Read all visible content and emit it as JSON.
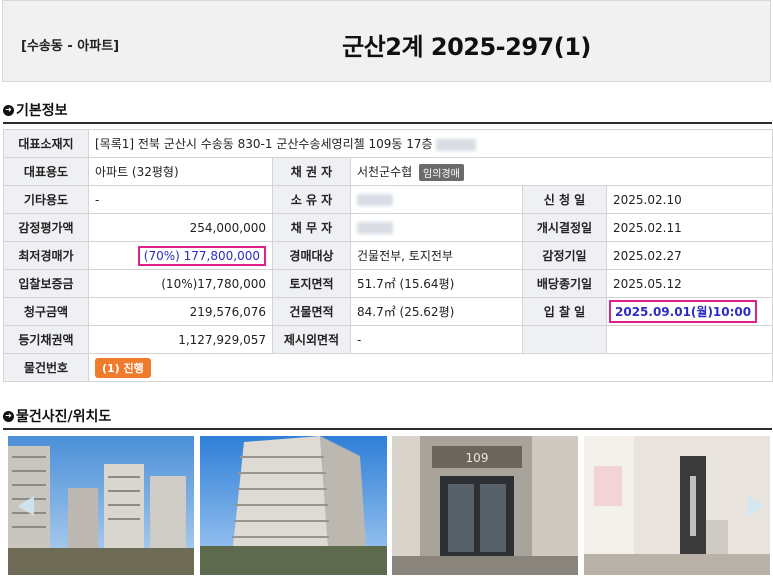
{
  "header": {
    "location": "[수송동 - 아파트]",
    "case_number": "군산2계 2025-297(1)"
  },
  "sections": {
    "basic_info": "기본정보",
    "photos": "물건사진/위치도"
  },
  "rows": {
    "address": {
      "label": "대표소재지",
      "value": "[목록1] 전북 군산시 수송동 830-1 군산수송세영리첼 109동 17층"
    },
    "main_use": {
      "label": "대표용도",
      "value": "아파트 (32평형)"
    },
    "creditor": {
      "label": "채 권 자",
      "value": "서천군수협",
      "tag": "임의경매"
    },
    "other_use": {
      "label": "기타용도",
      "value": "-"
    },
    "owner": {
      "label": "소 유 자"
    },
    "request_date": {
      "label": "신 청 일",
      "value": "2025.02.10"
    },
    "appraisal": {
      "label": "감정평가액",
      "value": "254,000,000"
    },
    "debtor": {
      "label": "채 무 자"
    },
    "start_decision": {
      "label": "개시결정일",
      "value": "2025.02.11"
    },
    "min_price": {
      "label": "최저경매가",
      "value": "(70%) 177,800,000"
    },
    "auction_target": {
      "label": "경매대상",
      "value": "건물전부, 토지전부"
    },
    "appraisal_date": {
      "label": "감정기일",
      "value": "2025.02.27"
    },
    "deposit": {
      "label": "입찰보증금",
      "value": "(10%)17,780,000"
    },
    "land_area": {
      "label": "토지면적",
      "value": "51.7㎡ (15.64평)"
    },
    "dividend_end": {
      "label": "배당종기일",
      "value": "2025.05.12"
    },
    "claim": {
      "label": "청구금액",
      "value": "219,576,076"
    },
    "building_area": {
      "label": "건물면적",
      "value": "84.7㎡ (25.62평)"
    },
    "bid_date": {
      "label": "입 찰 일",
      "value": "2025.09.01(월)10:00"
    },
    "registered_claim": {
      "label": "등기채권액",
      "value": "1,127,929,057"
    },
    "excluded_area": {
      "label": "제시외면적",
      "value": "-"
    },
    "item_no": {
      "label": "물건번호",
      "value": "(1) 진행"
    }
  },
  "colors": {
    "highlight_border": "#e0208f",
    "highlight_text": "#2c2cc4",
    "status_orange": "#f07b2d"
  },
  "photos": [
    "building-exterior-photo",
    "tower-photo",
    "entrance-photo",
    "interior-hallway-photo"
  ]
}
